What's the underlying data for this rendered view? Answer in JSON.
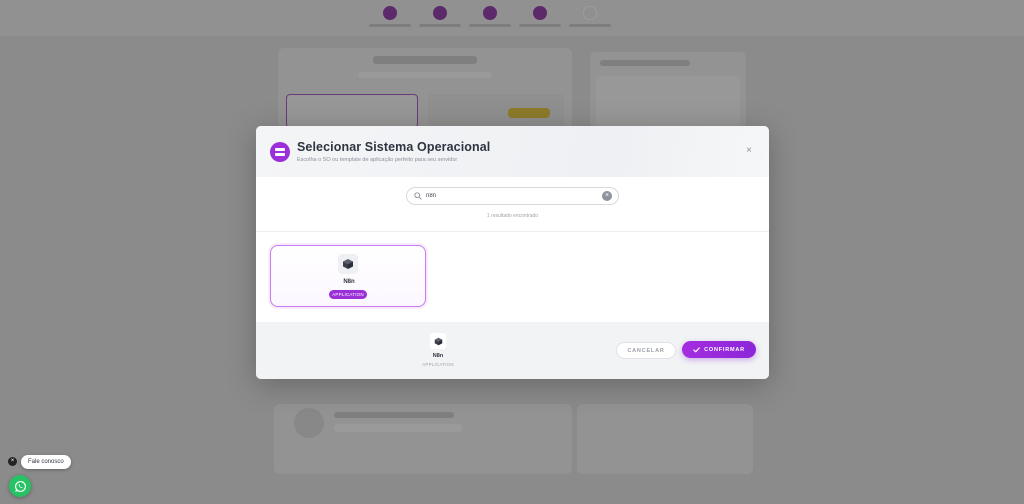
{
  "modal": {
    "title": "Selecionar Sistema Operacional",
    "subtitle": "Escolha o SO ou template de aplicação perfeito para seu servidor",
    "close_label": "×",
    "search": {
      "value": "n8n",
      "clear_label": "×"
    },
    "results_text": "1 resultado encontrado",
    "options": [
      {
        "name": "N8n",
        "badge": "APPLICATION",
        "icon": "n8n-cube-icon"
      }
    ],
    "selected": {
      "name": "N8n",
      "type": "APPLICATION",
      "icon": "n8n-cube-icon"
    },
    "cancel_label": "CANCELAR",
    "confirm_label": "CONFIRMAR"
  },
  "chat": {
    "bubble_text": "Fale conosco",
    "close_label": "×",
    "icon": "whatsapp-icon"
  },
  "colors": {
    "accent": "#9b30d9",
    "whatsapp": "#25c364",
    "overlay": "#8b8b8b"
  }
}
